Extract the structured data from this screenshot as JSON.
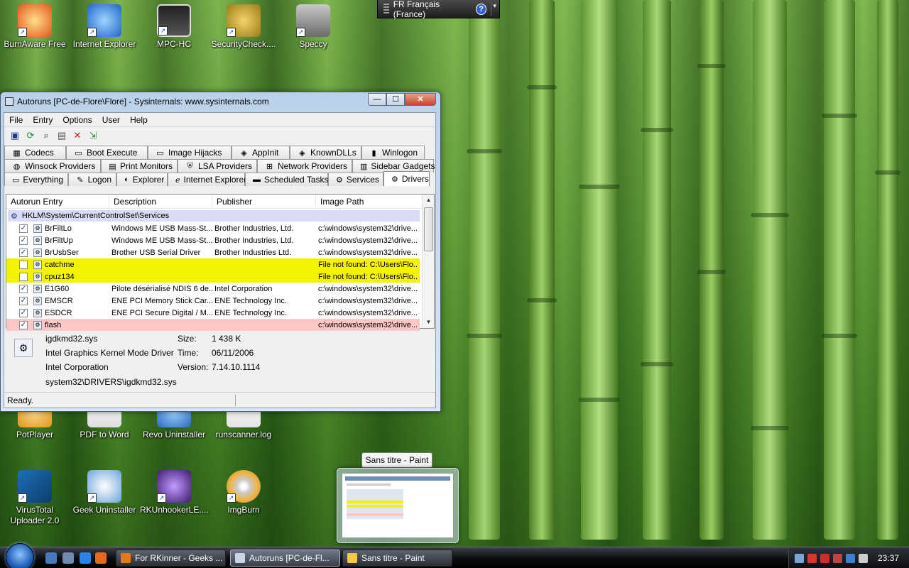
{
  "desktop": {
    "icons_top": [
      {
        "label": "BurnAware Free"
      },
      {
        "label": "Internet Explorer"
      },
      {
        "label": "MPC-HC"
      },
      {
        "label": "SecurityCheck...."
      },
      {
        "label": "Speccy"
      }
    ],
    "icons_mid": [
      {
        "label": "PotPlayer"
      },
      {
        "label": "PDF to Word"
      },
      {
        "label": "Revo Uninstaller"
      },
      {
        "label": "runscanner.log"
      }
    ],
    "icons_bottom": [
      {
        "label": "VirusTotal Uploader 2.0"
      },
      {
        "label": "Geek Uninstaller"
      },
      {
        "label": "RKUnhookerLE...."
      },
      {
        "label": "ImgBurn"
      }
    ]
  },
  "langbar": {
    "text": "FR Français (France)",
    "help": "?"
  },
  "window": {
    "title": "Autoruns [PC-de-Flore\\Flore] - Sysinternals: www.sysinternals.com",
    "buttons": {
      "minimize": "—",
      "maximize": "☐",
      "close": "✕"
    },
    "menu": [
      "File",
      "Entry",
      "Options",
      "User",
      "Help"
    ],
    "tabs_row1": [
      "Codecs",
      "Boot Execute",
      "Image Hijacks",
      "AppInit",
      "KnownDLLs",
      "Winlogon"
    ],
    "tabs_row2": [
      "Winsock Providers",
      "Print Monitors",
      "LSA Providers",
      "Network Providers",
      "Sidebar Gadgets"
    ],
    "tabs_row3": [
      "Everything",
      "Logon",
      "Explorer",
      "Internet Explorer",
      "Scheduled Tasks",
      "Services",
      "Drivers"
    ],
    "active_tab": "Drivers",
    "columns": [
      "Autorun Entry",
      "Description",
      "Publisher",
      "Image Path"
    ],
    "group": "HKLM\\System\\CurrentControlSet\\Services",
    "rows": [
      {
        "checked": true,
        "entry": "BrFiltLo",
        "description": "Windows ME USB Mass-St...",
        "publisher": "Brother Industries, Ltd.",
        "path": "c:\\windows\\system32\\drive...",
        "highlight": "none"
      },
      {
        "checked": true,
        "entry": "BrFiltUp",
        "description": "Windows ME USB Mass-St...",
        "publisher": "Brother Industries, Ltd.",
        "path": "c:\\windows\\system32\\drive...",
        "highlight": "none"
      },
      {
        "checked": true,
        "entry": "BrUsbSer",
        "description": "Brother USB Serial Driver",
        "publisher": "Brother Industries Ltd.",
        "path": "c:\\windows\\system32\\drive...",
        "highlight": "none"
      },
      {
        "checked": false,
        "entry": "catchme",
        "description": "",
        "publisher": "",
        "path": "File not found: C:\\Users\\Flo...",
        "highlight": "yellow"
      },
      {
        "checked": false,
        "entry": "cpuz134",
        "description": "",
        "publisher": "",
        "path": "File not found: C:\\Users\\Flo...",
        "highlight": "yellow"
      },
      {
        "checked": true,
        "entry": "E1G60",
        "description": "Pilote désérialisé NDIS 6 de...",
        "publisher": "Intel Corporation",
        "path": "c:\\windows\\system32\\drive...",
        "highlight": "none"
      },
      {
        "checked": true,
        "entry": "EMSCR",
        "description": "ENE PCI Memory Stick Car...",
        "publisher": "ENE Technology Inc.",
        "path": "c:\\windows\\system32\\drive...",
        "highlight": "none"
      },
      {
        "checked": true,
        "entry": "ESDCR",
        "description": "ENE PCI Secure Digital / M...",
        "publisher": "ENE Technology Inc.",
        "path": "c:\\windows\\system32\\drive...",
        "highlight": "none"
      },
      {
        "checked": true,
        "entry": "flash",
        "description": "",
        "publisher": "",
        "path": "c:\\windows\\system32\\drive...",
        "highlight": "pink"
      }
    ],
    "details": {
      "file": "igdkmd32.sys",
      "description": "Intel Graphics Kernel Mode Driver",
      "company": "Intel Corporation",
      "path": "system32\\DRIVERS\\igdkmd32.sys",
      "size_label": "Size:",
      "size": "1 438 K",
      "time_label": "Time:",
      "time": "06/11/2006",
      "version_label": "Version:",
      "version": "7.14.10.1114"
    },
    "status": "Ready."
  },
  "preview": {
    "title": "Sans titre - Paint"
  },
  "taskbar": {
    "buttons": [
      {
        "label": "For RKinner - Geeks ...",
        "color": "#e07a1f"
      },
      {
        "label": "Autoruns [PC-de-Fl...",
        "color": "#c9d6e6"
      },
      {
        "label": "Sans titre - Paint",
        "color": "#f2c94c"
      }
    ],
    "clock": "23:37"
  },
  "colors": {
    "yellow": "#f3f300",
    "pink": "#ffc6c6",
    "group": "#d9dcf4"
  }
}
